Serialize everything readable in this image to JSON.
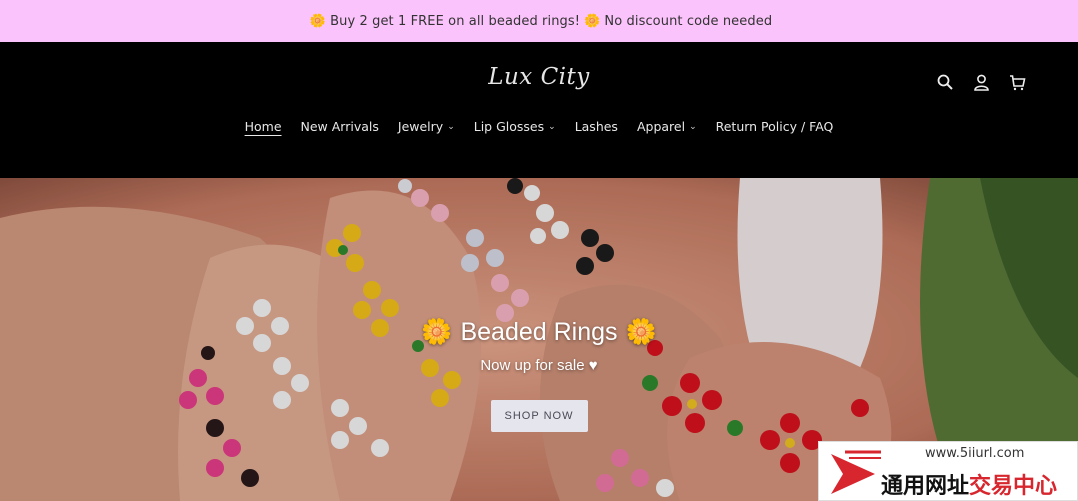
{
  "announcement": {
    "text": "Buy 2 get 1 FREE on all beaded rings!",
    "text2": "No discount code needed",
    "icon": "flower-emoji"
  },
  "header": {
    "logo": "Lux City",
    "icons": [
      "search-icon",
      "account-icon",
      "cart-icon"
    ]
  },
  "nav": {
    "items": [
      {
        "label": "Home",
        "dropdown": false,
        "active": true
      },
      {
        "label": "New Arrivals",
        "dropdown": false
      },
      {
        "label": "Jewelry",
        "dropdown": true
      },
      {
        "label": "Lip Glosses",
        "dropdown": true
      },
      {
        "label": "Lashes",
        "dropdown": false
      },
      {
        "label": "Apparel",
        "dropdown": true
      },
      {
        "label": "Return Policy / FAQ",
        "dropdown": false
      }
    ]
  },
  "hero": {
    "title": "Beaded Rings",
    "subtitle": "Now up for sale ♥",
    "button": "SHOP NOW"
  },
  "watermark": {
    "url": "www.5iiurl.com",
    "text_black": "通用网址",
    "text_red": "交易中心"
  },
  "colors": {
    "announcement_bg": "#fbc3fb",
    "header_bg": "#000000",
    "button_bg": "#e5e5ee"
  }
}
